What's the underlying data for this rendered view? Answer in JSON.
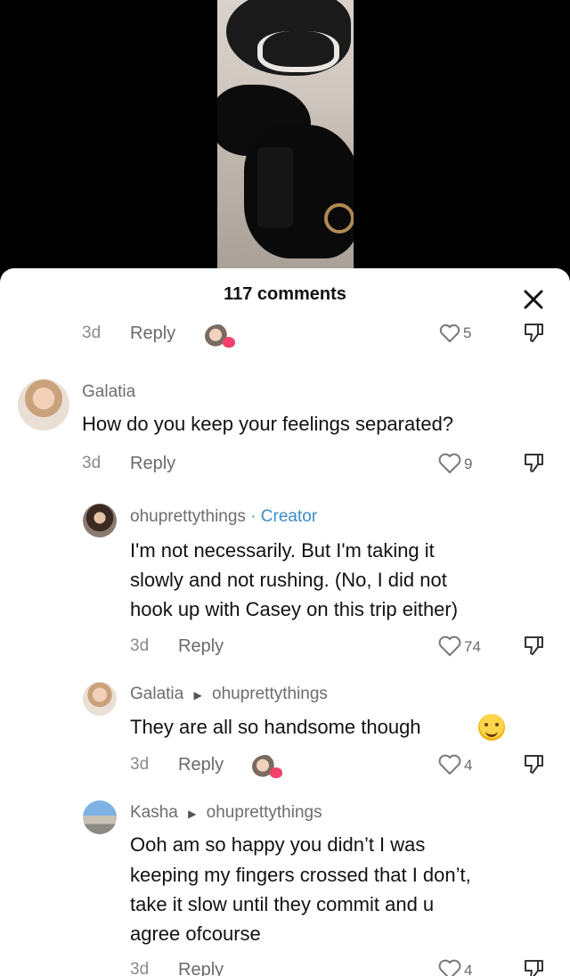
{
  "sheet": {
    "title": "117 comments"
  },
  "comments": [
    {
      "age": "3d",
      "reply": "Reply",
      "likes": "5"
    },
    {
      "user": "Galatia",
      "text": "How do you keep your feelings separated?",
      "age": "3d",
      "reply": "Reply",
      "likes": "9"
    },
    {
      "user": "ohuprettythings",
      "badge": "· Creator",
      "text_lines": [
        "I'm not necessarily. But I'm taking it",
        "slowly and not rushing. (No, I did not",
        "hook up with Casey on this trip either)"
      ],
      "age": "3d",
      "reply": "Reply",
      "likes": "74"
    },
    {
      "user": "Galatia",
      "reply_to": "ohuprettythings",
      "text": "They are all so handsome though",
      "age": "3d",
      "reply": "Reply",
      "likes": "4"
    },
    {
      "user": "Kasha",
      "reply_to": "ohuprettythings",
      "text_lines": [
        "Ooh am so happy you didn’t I was",
        "keeping my fingers crossed that I don’t,",
        "take it slow until they commit and u",
        "agree ofcourse"
      ],
      "age": "3d",
      "reply": "Reply",
      "likes": "4"
    }
  ],
  "icons": {
    "close": "close-icon",
    "like": "heart-outline-icon",
    "dislike": "thumbs-down-icon",
    "reply_arrow": "caret-right-icon"
  },
  "colors": {
    "creator_badge": "#3d8cc4",
    "background_top": "#000000",
    "sheet": "#ffffff"
  }
}
